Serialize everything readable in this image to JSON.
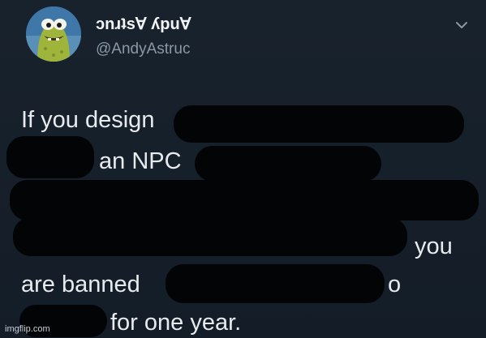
{
  "user": {
    "display_name": "ɔnɹʇs∀ ʎpu∀",
    "handle": "@AndyAstruc",
    "avatar": "cartoon-fish-avatar-icon"
  },
  "tweet": {
    "line1": "If you design",
    "line2": "an NPC",
    "line5": "you",
    "line6a": "are banned",
    "line6b": "o",
    "line7": "for one year."
  },
  "icons": {
    "menu": "chevron-down-icon"
  },
  "watermark": "imgflip.com",
  "colors": {
    "background": "#16202b",
    "text": "#e8ebee",
    "handle": "#8a98a6",
    "redaction": "#030405"
  }
}
